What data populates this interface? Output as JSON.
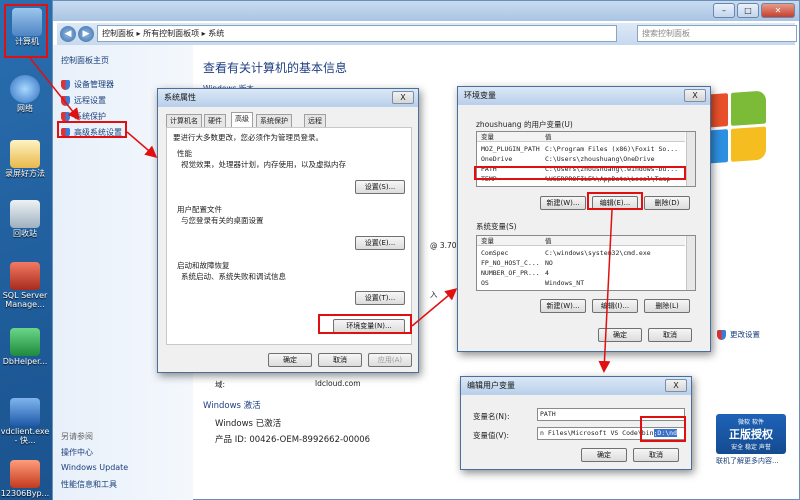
{
  "desktop": {
    "icons": [
      {
        "label": "计算机",
        "color": "#7fb0e0"
      },
      {
        "label": "网络",
        "color": "#5d9bd8"
      },
      {
        "label": "录屏好方法",
        "color": "#f0c060"
      },
      {
        "label": "回收站",
        "color": "#c8d4de"
      },
      {
        "label": "SQL Server Manage...",
        "color": "#d24a3a"
      },
      {
        "label": "DbHelper...",
        "color": "#2fae4e"
      },
      {
        "label": "vdclient.exe - 快...",
        "color": "#3a7ac8"
      },
      {
        "label": "12306Byp...",
        "color": "#e05a3a"
      }
    ]
  },
  "explorer": {
    "address": "控制面板 ▸ 所有控制面板项 ▸ 系统",
    "search_placeholder": "搜索控制面板",
    "left": {
      "home": "控制面板主页",
      "links": [
        "设备管理器",
        "远程设置",
        "系统保护",
        "高级系统设置"
      ],
      "see_also_title": "另请参阅",
      "see_also": [
        "操作中心",
        "Windows Update",
        "性能信息和工具"
      ]
    },
    "main_title": "查看有关计算机的基本信息",
    "windows_edition": "Windows 版本",
    "cpu_fragment": "@ 3.70",
    "input_fragment": "入",
    "domain_label": "域:",
    "domain_value": "ldcloud.com",
    "activation_title": "Windows 激活",
    "activation_status": "Windows 已激活",
    "product_id": "产品 ID: 00426-OEM-8992662-00006",
    "change_settings": "更改设置",
    "genuine_badge": {
      "top": "微软 软件",
      "main": "正版授权",
      "sub": "安全 稳定 声誉"
    },
    "genuine_link": "联机了解更多内容..."
  },
  "sysprops": {
    "title": "系统属性",
    "close": "X",
    "tabs": [
      "计算机名",
      "硬件",
      "高级",
      "系统保护",
      "远程"
    ],
    "admin_note": "要进行大多数更改，您必须作为管理员登录。",
    "perf_title": "性能",
    "perf_desc": "视觉效果，处理器计划，内存使用，以及虚拟内存",
    "profile_title": "用户配置文件",
    "profile_desc": "与您登录有关的桌面设置",
    "startup_title": "启动和故障恢复",
    "startup_desc": "系统启动、系统失败和调试信息",
    "settings_btn": [
      "设置(S)...",
      "设置(E)...",
      "设置(T)..."
    ],
    "env_btn": "环境变量(N)...",
    "ok": "确定",
    "cancel": "取消",
    "apply": "应用(A)"
  },
  "envvars": {
    "title": "环境变量",
    "close": "X",
    "user_title": "zhoushuang 的用户变量(U)",
    "col_var": "变量",
    "col_val": "值",
    "user_rows": [
      {
        "name": "MOZ_PLUGIN_PATH",
        "value": "C:\\Program Files (x86)\\Foxit So..."
      },
      {
        "name": "OneDrive",
        "value": "C:\\Users\\zhoushuang\\OneDrive"
      },
      {
        "name": "PATH",
        "value": "C:\\Users\\zhoushuang\\.windows-bu..."
      },
      {
        "name": "TEMP",
        "value": "%USERPROFILE%\\AppData\\Local\\Temp"
      }
    ],
    "sys_title": "系统变量(S)",
    "sys_rows": [
      {
        "name": "ComSpec",
        "value": "C:\\windows\\system32\\cmd.exe"
      },
      {
        "name": "FP_NO_HOST_C...",
        "value": "NO"
      },
      {
        "name": "NUMBER_OF_PR...",
        "value": "4"
      },
      {
        "name": "OS",
        "value": "Windows_NT"
      }
    ],
    "btn_new": "新建(W)...",
    "btn_edit": "编辑(E)...",
    "btn_delete": "删除(D)",
    "btn_new_s": "新建(W)...",
    "btn_edit_s": "编辑(I)...",
    "btn_delete_s": "删除(L)",
    "ok": "确定",
    "cancel": "取消"
  },
  "editvar": {
    "title": "编辑用户变量",
    "name_label": "变量名(N):",
    "name_value": "PATH",
    "value_label": "变量值(V):",
    "value_text": "n Files\\Microsoft VS Code\\bin",
    "value_selected": ";D:\\nd",
    "ok": "确定",
    "cancel": "取消"
  },
  "accent": {
    "highlight": "#e01010",
    "link": "#1a3e7a"
  }
}
